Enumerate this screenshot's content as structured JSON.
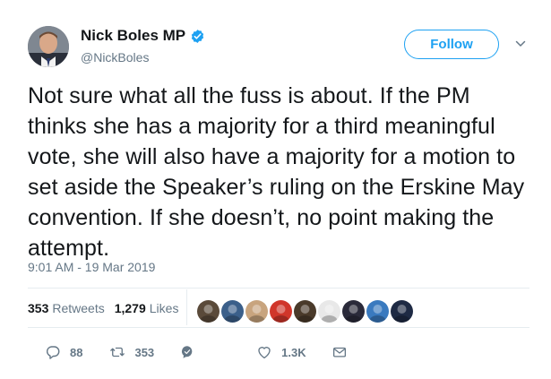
{
  "author": {
    "name": "Nick Boles MP",
    "handle": "@NickBoles"
  },
  "follow_label": "Follow",
  "tweet": {
    "text": "Not sure what all the fuss is about. If the PM thinks she has a majority for a third meaningful vote, she will also have a majority for a motion to set aside the Speaker’s ruling on the Erskine May convention. If she doesn’t, no point making the attempt.",
    "timestamp": "9:01 AM - 19 Mar 2019"
  },
  "stats": {
    "retweets_count": "353",
    "retweets_label": "Retweets",
    "likes_count": "1,279",
    "likes_label": "Likes"
  },
  "likers": [
    {
      "color": "#5a4a3a"
    },
    {
      "color": "#3b5f8a"
    },
    {
      "color": "#c8a47e"
    },
    {
      "color": "#d0362b"
    },
    {
      "color": "#4a3a2a"
    },
    {
      "color": "#e8e8e8"
    },
    {
      "color": "#2a2a3a"
    },
    {
      "color": "#3a7abf"
    },
    {
      "color": "#1e2a44"
    }
  ],
  "actions": {
    "replies_count": "88",
    "retweets_count": "353",
    "likes_count": "1.3K"
  },
  "colors": {
    "accent": "#1da1f2",
    "muted": "#657786",
    "verified": "#1da1f2"
  }
}
